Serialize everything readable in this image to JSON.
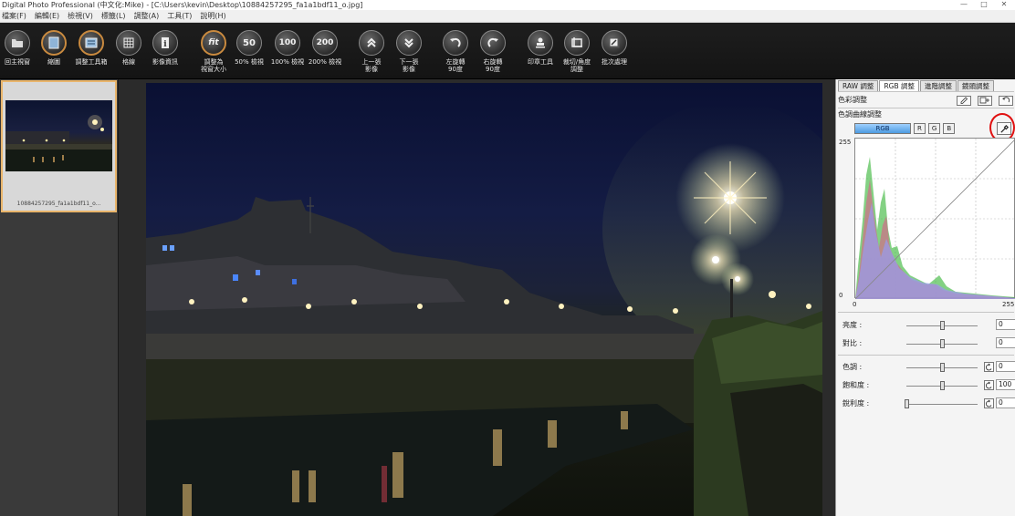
{
  "window": {
    "title": "Digital Photo Professional (中文化:Mike) - [C:\\Users\\kevin\\Desktop\\10884257295_fa1a1bdf11_o.jpg]",
    "controls": [
      "—",
      "□",
      "✕"
    ]
  },
  "menu": [
    "檔案(F)",
    "編輯(E)",
    "檢視(V)",
    "標籤(L)",
    "調整(A)",
    "工具(T)",
    "說明(H)"
  ],
  "toolbar": [
    {
      "label": "回主視窗",
      "icon": "folder-icon",
      "glyph": ""
    },
    {
      "label": "縮圖",
      "icon": "thumbnail-icon",
      "glyph": ""
    },
    {
      "label": "調整工具箱",
      "icon": "toolbox-icon",
      "glyph": ""
    },
    {
      "label": "格線",
      "icon": "grid-icon",
      "glyph": ""
    },
    {
      "label": "影像資訊",
      "icon": "info-icon",
      "glyph": ""
    },
    {
      "label": "調整為\n視窗大小",
      "icon": "fit-icon",
      "glyph": "fit"
    },
    {
      "label": "50% 檢視",
      "icon": "zoom-50-icon",
      "glyph": "50"
    },
    {
      "label": "100% 檢視",
      "icon": "zoom-100-icon",
      "glyph": "100"
    },
    {
      "label": "200% 檢視",
      "icon": "zoom-200-icon",
      "glyph": "200"
    },
    {
      "label": "上一張\n影像",
      "icon": "prev-image-icon",
      "glyph": ""
    },
    {
      "label": "下一張\n影像",
      "icon": "next-image-icon",
      "glyph": ""
    },
    {
      "label": "左旋轉\n90度",
      "icon": "rotate-left-icon",
      "glyph": ""
    },
    {
      "label": "右旋轉\n90度",
      "icon": "rotate-right-icon",
      "glyph": ""
    },
    {
      "label": "印章工具",
      "icon": "stamp-icon",
      "glyph": ""
    },
    {
      "label": "裁切/角度\n調整",
      "icon": "crop-icon",
      "glyph": ""
    },
    {
      "label": "批次處理",
      "icon": "batch-icon",
      "glyph": ""
    }
  ],
  "thumbnail": {
    "filename": "10884257295_fa1a1bdf11_o..."
  },
  "panel": {
    "tabs": [
      "RAW 調整",
      "RGB 調整",
      "進階調整",
      "鏡頭調整"
    ],
    "active_tab": 1,
    "color_adjust_title": "色彩調整",
    "curve_title": "色調曲線調整",
    "channels": [
      "RGB",
      "R",
      "G",
      "B"
    ],
    "active_channel": "RGB",
    "axis": {
      "y_top": "255",
      "y_bottom": "0",
      "x_left": "0",
      "x_right": "255"
    },
    "sliders": [
      {
        "label": "亮度 :",
        "value": "0",
        "level": 0.5,
        "reset": false
      },
      {
        "label": "對比 :",
        "value": "0",
        "level": 0.5,
        "reset": false
      },
      {
        "label": "色調 :",
        "value": "0",
        "level": 0.5,
        "reset": true
      },
      {
        "label": "飽和度 :",
        "value": "100",
        "level": 0.5,
        "reset": true
      },
      {
        "label": "銳利度 :",
        "value": "0",
        "level": 0.0,
        "reset": true
      }
    ]
  },
  "colors": {
    "accent_blue": "#4d9be0",
    "highlight_orange": "#e9b56b",
    "annotation_red": "#e01010"
  }
}
